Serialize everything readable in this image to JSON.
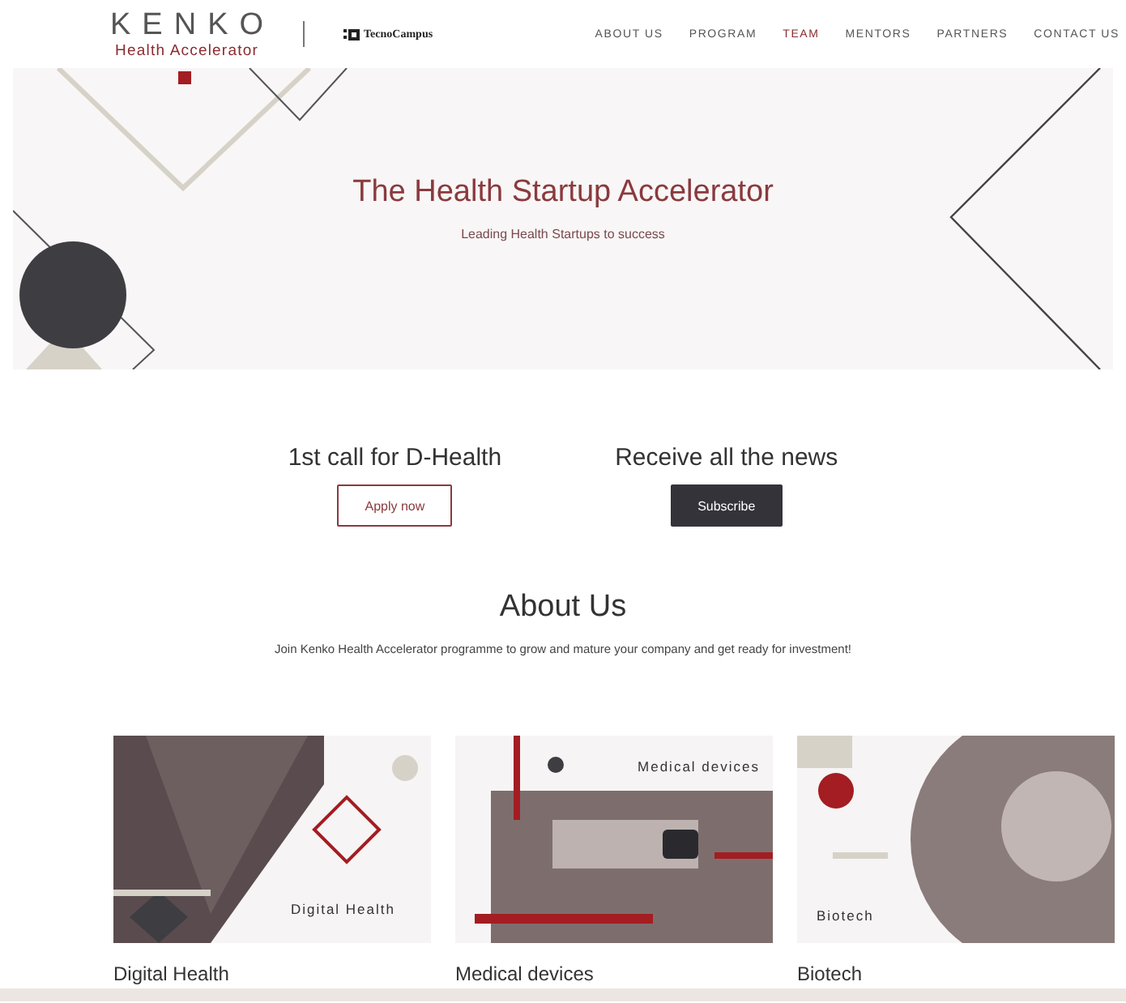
{
  "header": {
    "logo_title": "KENKO",
    "logo_subtitle": "Health Accelerator",
    "partner_logo": "TecnoCampus",
    "nav": [
      {
        "label": "ABOUT US",
        "selected": false
      },
      {
        "label": "PROGRAM",
        "selected": false
      },
      {
        "label": "TEAM",
        "selected": true
      },
      {
        "label": "MENTORS",
        "selected": false
      },
      {
        "label": "PARTNERS",
        "selected": false
      },
      {
        "label": "CONTACT US",
        "selected": false
      }
    ]
  },
  "hero": {
    "title": "The Health Startup Accelerator",
    "subtitle": "Leading Health Startups to success"
  },
  "calls": [
    {
      "heading": "1st call for D-Health",
      "button": "Apply now",
      "kind": "outline"
    },
    {
      "heading": "Receive all the news",
      "button": "Subscribe",
      "kind": "solid"
    }
  ],
  "about": {
    "heading": "About Us",
    "text": "Join Kenko Health Accelerator programme to grow and mature your company and get ready for investment!"
  },
  "cards": [
    {
      "image_label": "Digital Health",
      "title": "Digital Health"
    },
    {
      "image_label": "Medical devices",
      "title": "Medical devices"
    },
    {
      "image_label": "Biotech",
      "title": "Biotech"
    }
  ]
}
